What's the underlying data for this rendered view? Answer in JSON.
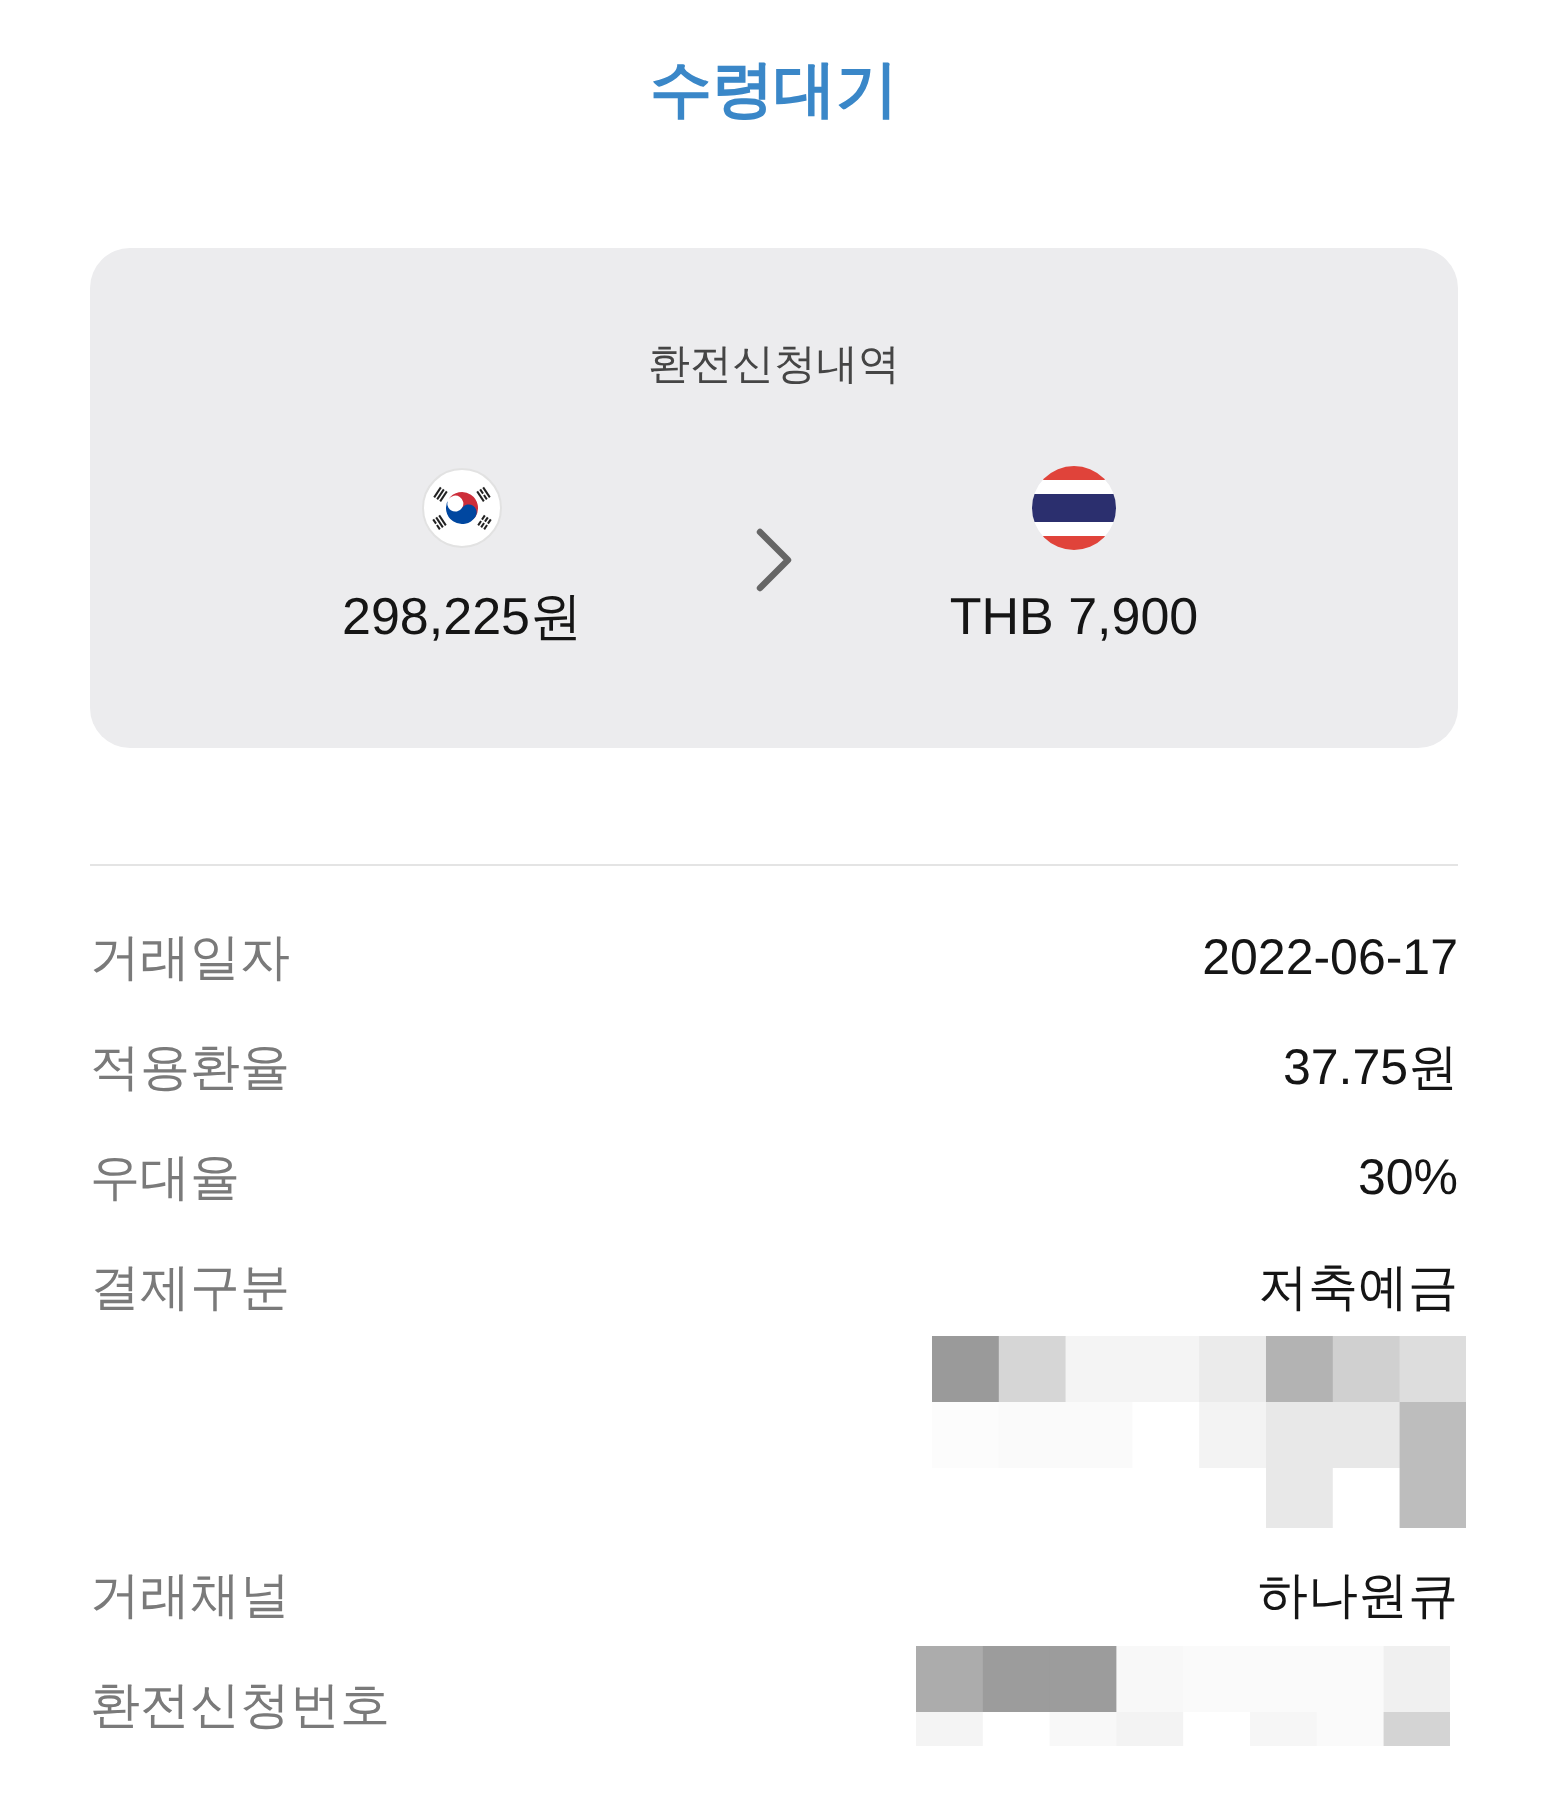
{
  "header": {
    "title": "수령대기"
  },
  "summary": {
    "title": "환전신청내역",
    "from": {
      "amount": "298,225원"
    },
    "to": {
      "amount": "THB 7,900"
    }
  },
  "details": [
    {
      "label": "거래일자",
      "value": "2022-06-17",
      "kind": "text"
    },
    {
      "label": "적용환율",
      "value": "37.75원",
      "kind": "text"
    },
    {
      "label": "우대율",
      "value": "30%",
      "kind": "text"
    },
    {
      "label": "결제구분",
      "value": "저축예금",
      "kind": "text_masked"
    },
    {
      "label": "거래채널",
      "value": "하나원큐",
      "kind": "text"
    },
    {
      "label": "환전신청번호",
      "kind": "masked"
    }
  ]
}
